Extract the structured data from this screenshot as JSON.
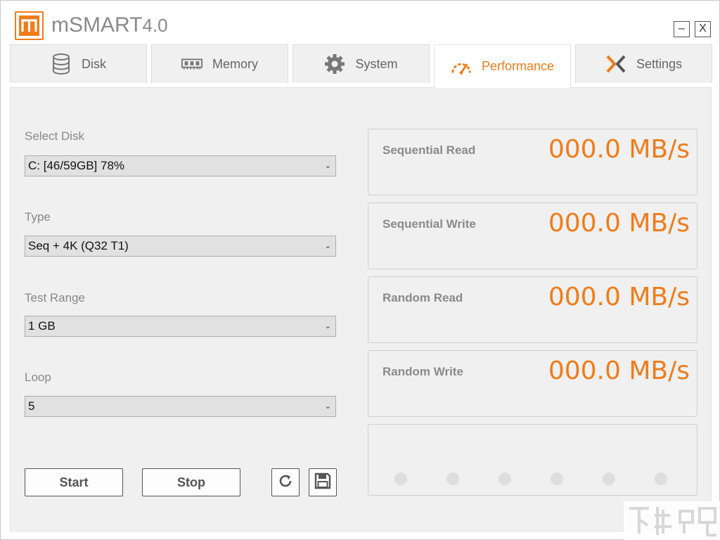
{
  "app": {
    "title": "mSMART",
    "version": "4.0",
    "minimize_label": "–",
    "close_label": "X"
  },
  "tabs": [
    {
      "label": "Disk",
      "icon": "database-icon"
    },
    {
      "label": "Memory",
      "icon": "memory-chip-icon"
    },
    {
      "label": "System",
      "icon": "gear-icon"
    },
    {
      "label": "Performance",
      "icon": "speedometer-icon"
    },
    {
      "label": "Settings",
      "icon": "tools-icon"
    }
  ],
  "active_tab": "Performance",
  "form": {
    "select_disk_label": "Select Disk",
    "select_disk_value": "C: [46/59GB] 78%",
    "type_label": "Type",
    "type_value": "Seq + 4K (Q32 T1)",
    "range_label": "Test Range",
    "range_value": "1 GB",
    "loop_label": "Loop",
    "loop_value": "5"
  },
  "buttons": {
    "start": "Start",
    "stop": "Stop",
    "refresh_icon": "refresh-icon",
    "save_icon": "floppy-disk-icon"
  },
  "results": [
    {
      "label": "Sequential Read",
      "value": "000.0 MB/s"
    },
    {
      "label": "Sequential Write",
      "value": "000.0 MB/s"
    },
    {
      "label": "Random Read",
      "value": "000.0 MB/s"
    },
    {
      "label": "Random Write",
      "value": "000.0 MB/s"
    }
  ],
  "progress_dots": 6,
  "colors": {
    "accent": "#f07c1a",
    "panel": "#f0f0f0",
    "text_muted": "#888888"
  }
}
